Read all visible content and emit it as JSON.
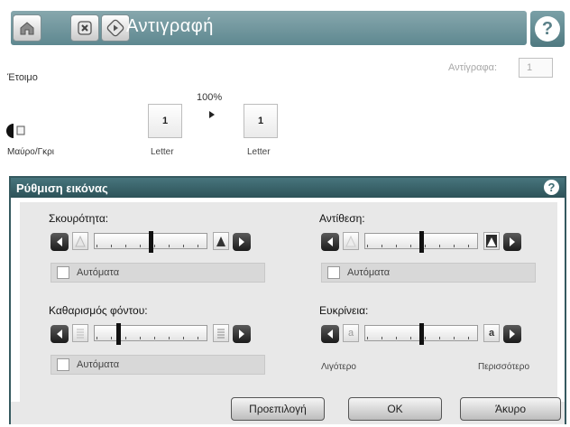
{
  "header": {
    "title": "Αντιγραφή",
    "home_icon": "home-icon",
    "stop_icon": "stop-icon",
    "start_icon": "start-icon",
    "help_icon": "help-icon",
    "help_glyph": "?"
  },
  "status": {
    "text": "Έτοιμο",
    "copies_label": "Αντίγραφα:",
    "copies_value": "1"
  },
  "preview": {
    "zoom": "100%",
    "source_count": "1",
    "source_size": "Letter",
    "dest_count": "1",
    "dest_size": "Letter",
    "color_mode": "Μαύρο/Γκρι"
  },
  "panel": {
    "title": "Ρύθμιση εικόνας",
    "help_glyph": "?",
    "darkness": {
      "label": "Σκουρότητα:",
      "auto_label": "Αυτόματα",
      "level": 0.5
    },
    "contrast": {
      "label": "Αντίθεση:",
      "auto_label": "Αυτόματα",
      "level": 0.5
    },
    "background_cleanup": {
      "label": "Καθαρισμός φόντου:",
      "auto_label": "Αυτόματα",
      "level": 0.2
    },
    "sharpness": {
      "label": "Ευκρίνεια:",
      "left_icon_glyph": "a",
      "right_icon_glyph": "a",
      "level": 0.5,
      "min_label": "Λιγότερο",
      "max_label": "Περισσότερο"
    }
  },
  "buttons": {
    "default": "Προεπιλογή",
    "ok": "ΟΚ",
    "cancel": "Άκυρο"
  }
}
